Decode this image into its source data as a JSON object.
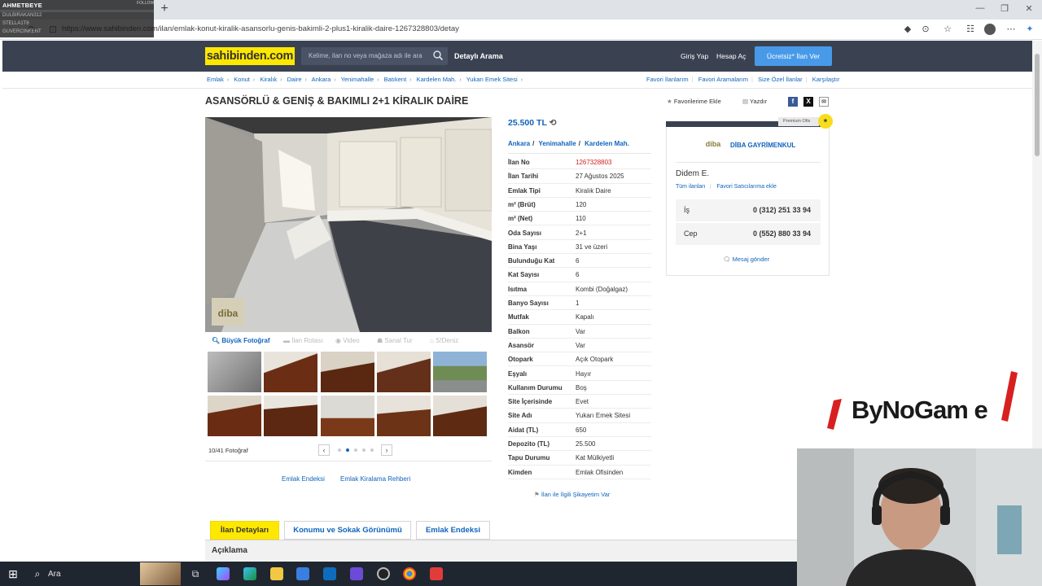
{
  "overlay": {
    "streamer": "AHMETBEYE",
    "follow": "FOLLOW",
    "lines": [
      "DULBIRAKAN312",
      "STELLA1T6",
      "GUVERCINKENT"
    ]
  },
  "browser": {
    "url": "https://www.sahibinden.com/ilan/emlak-konut-kiralik-asansorlu-genis-bakimli-2-plus1-kiralik-daire-1267328803/detay",
    "new_tab": "+"
  },
  "header": {
    "logo": "sahibinden.com",
    "search_placeholder": "Kelime, ilan no veya mağaza adı ile ara",
    "advanced_search": "Detaylı Arama",
    "login": "Giriş Yap",
    "register": "Hesap Aç",
    "post_ad": "Ücretsiz* İlan Ver"
  },
  "breadcrumb": [
    "Emlak",
    "Konut",
    "Kiralık",
    "Daire",
    "Ankara",
    "Yenimahalle",
    "Batıkent",
    "Kardelen Mah.",
    "Yukarı Emek Sitesi"
  ],
  "crumb_right": [
    "Favori İlanlarım",
    "Favori Aramalarım",
    "Size Özel İlanlar",
    "Karşılaştır"
  ],
  "listing": {
    "title": "ASANSÖRLÜ & GENİŞ & BAKIMLI 2+1 KİRALIK DAİRE",
    "favorite": "Favorilerime Ekle",
    "print": "Yazdır",
    "price": "25.500 TL",
    "location": [
      "Ankara",
      "Yenimahalle",
      "Kardelen Mah."
    ],
    "details": [
      {
        "k": "İlan No",
        "v": "1267328803"
      },
      {
        "k": "İlan Tarihi",
        "v": "27 Ağustos 2025"
      },
      {
        "k": "Emlak Tipi",
        "v": "Kiralık Daire"
      },
      {
        "k": "m² (Brüt)",
        "v": "120"
      },
      {
        "k": "m² (Net)",
        "v": "110"
      },
      {
        "k": "Oda Sayısı",
        "v": "2+1"
      },
      {
        "k": "Bina Yaşı",
        "v": "31 ve üzeri"
      },
      {
        "k": "Bulunduğu Kat",
        "v": "6"
      },
      {
        "k": "Kat Sayısı",
        "v": "6"
      },
      {
        "k": "Isıtma",
        "v": "Kombi (Doğalgaz)"
      },
      {
        "k": "Banyo Sayısı",
        "v": "1"
      },
      {
        "k": "Mutfak",
        "v": "Kapalı"
      },
      {
        "k": "Balkon",
        "v": "Var"
      },
      {
        "k": "Asansör",
        "v": "Var"
      },
      {
        "k": "Otopark",
        "v": "Açık Otopark"
      },
      {
        "k": "Eşyalı",
        "v": "Hayır"
      },
      {
        "k": "Kullanım Durumu",
        "v": "Boş"
      },
      {
        "k": "Site İçerisinde",
        "v": "Evet"
      },
      {
        "k": "Site Adı",
        "v": "Yukarı Emek Sitesi"
      },
      {
        "k": "Aidat (TL)",
        "v": "650"
      },
      {
        "k": "Depozito (TL)",
        "v": "25.500"
      },
      {
        "k": "Tapu Durumu",
        "v": "Kat Mülkiyetli"
      },
      {
        "k": "Kimden",
        "v": "Emlak Ofisinden"
      }
    ],
    "complaint": "İlan ile İlgili Şikayetim Var"
  },
  "photos": {
    "nav": [
      "Büyük Fotoğraf",
      "İlan Rotası",
      "Video",
      "Sanal Tur",
      "S!Deniz"
    ],
    "count": "10/41 Fotoğraf",
    "bottom_links": [
      "Emlak Endeksi",
      "Emlak Kiralama Rehberi"
    ]
  },
  "seller": {
    "premium": "Premium Ofis",
    "firm": "DİBA GAYRİMENKUL",
    "name": "Didem E.",
    "links": [
      "Tüm ilanları",
      "Favori Satıcılarıma ekle"
    ],
    "phones": [
      {
        "label": "İş",
        "number": "0 (312) 251 33 94"
      },
      {
        "label": "Cep",
        "number": "0 (552) 880 33 94"
      }
    ],
    "message": "Mesaj gönder"
  },
  "tabs": [
    "İlan Detayları",
    "Konumu ve Sokak Görünümü",
    "Emlak Endeksi"
  ],
  "section_title": "Açıklama",
  "brand_overlay": "ByNoGam e",
  "taskbar": {
    "search": "Ara"
  },
  "colors": {
    "accent_yellow": "#ffe800",
    "header_bg": "#3a4252",
    "link_blue": "#1064bc",
    "button_blue": "#489ae9",
    "red": "#d0231e"
  }
}
